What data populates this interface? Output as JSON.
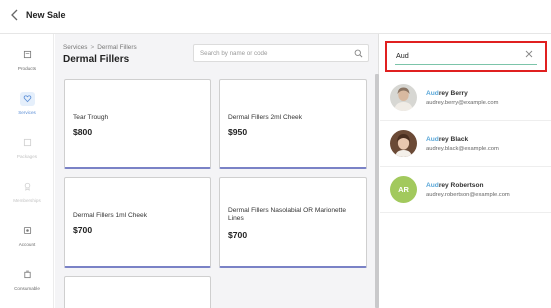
{
  "header": {
    "back_icon": "chevron-left-icon",
    "title": "New Sale"
  },
  "sidebar": {
    "items": [
      {
        "label": "Products",
        "icon": "box-icon",
        "state": "normal"
      },
      {
        "label": "Services",
        "icon": "heart-icon",
        "state": "active"
      },
      {
        "label": "Packages",
        "icon": "package-icon",
        "state": "disabled"
      },
      {
        "label": "Memberships",
        "icon": "badge-icon",
        "state": "disabled"
      },
      {
        "label": "Account",
        "icon": "account-icon",
        "state": "normal"
      },
      {
        "label": "Consumable",
        "icon": "consumable-icon",
        "state": "normal"
      }
    ]
  },
  "main": {
    "breadcrumb": {
      "root": "Services",
      "separator": ">",
      "current": "Dermal Fillers"
    },
    "title": "Dermal Fillers",
    "search": {
      "placeholder": "Search by name or code",
      "value": ""
    },
    "services": [
      {
        "name": "Tear Trough",
        "price": "$800"
      },
      {
        "name": "Dermal Fillers 2ml Cheek",
        "price": "$950"
      },
      {
        "name": "Dermal Fillers 1ml Cheek",
        "price": "$700"
      },
      {
        "name": "Dermal Fillers Nasolabial OR Marionette Lines",
        "price": "$700"
      },
      {
        "name": "",
        "price": ""
      }
    ]
  },
  "client_panel": {
    "search": {
      "value": "Aud",
      "clear_icon": "close-icon"
    },
    "clients": [
      {
        "match": "Aud",
        "rest": "rey Berry",
        "email": "audrey.berry@example.com",
        "avatar": "photo"
      },
      {
        "match": "Aud",
        "rest": "rey Black",
        "email": "audrey.black@example.com",
        "avatar": "photo"
      },
      {
        "match": "Aud",
        "rest": "rey Robertson",
        "email": "audrey.robertson@example.com",
        "avatar": "initials",
        "initials": "AR"
      }
    ]
  },
  "colors": {
    "accent": "#5aa7d8",
    "card_border": "#7a82c6",
    "highlight_border": "#e02020",
    "initials_avatar": "#a2c95d",
    "input_underline": "#7cc4a9"
  }
}
